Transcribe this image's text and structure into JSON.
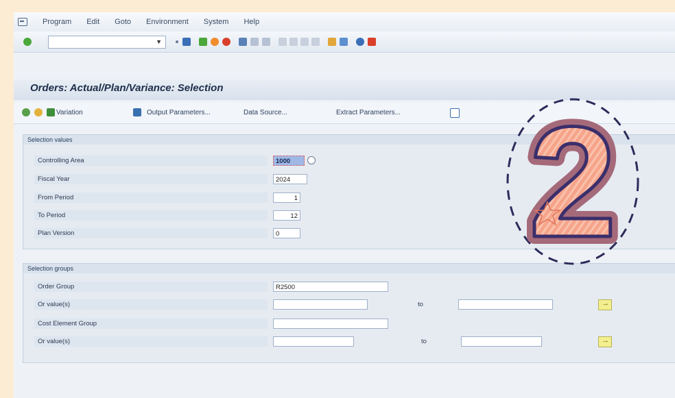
{
  "menu": [
    "Program",
    "Edit",
    "Goto",
    "Environment",
    "System",
    "Help"
  ],
  "toolbar": {
    "command_field": ""
  },
  "page": {
    "title": "Orders: Actual/Plan/Variance: Selection"
  },
  "app_toolbar": {
    "variation": "Variation",
    "output_parameters": "Output Parameters...",
    "data_source": "Data Source...",
    "extract_parameters": "Extract Parameters..."
  },
  "selection_values": {
    "header": "Selection values",
    "fields": [
      {
        "label": "Controlling Area",
        "value": "1000"
      },
      {
        "label": "Fiscal Year",
        "value": "2024"
      },
      {
        "label": "From Period",
        "value": "1"
      },
      {
        "label": "To Period",
        "value": "12"
      },
      {
        "label": "Plan Version",
        "value": "0"
      }
    ]
  },
  "selection_groups": {
    "header": "Selection groups",
    "order_group_label": "Order Group",
    "order_group_value": "R2500",
    "or_values_label_1": "Or value(s)",
    "to_label": "to",
    "cost_element_group_label": "Cost Element Group",
    "or_values_label_2": "Or value(s)"
  },
  "badge": {
    "number": "2",
    "fill": "#f6a48a",
    "outline": "#3b2f6b",
    "border": "#a56a7a"
  }
}
